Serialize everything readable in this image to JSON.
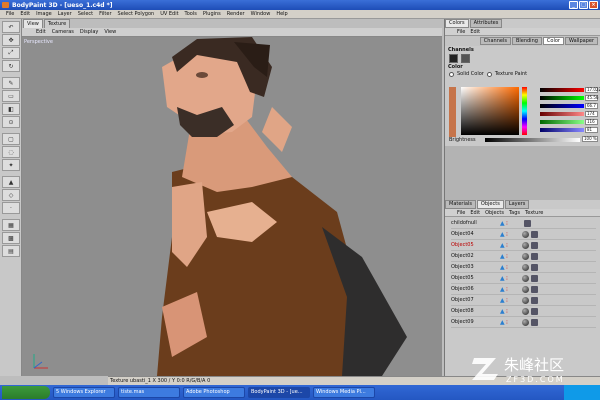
{
  "window": {
    "title": "BodyPaint 3D - [ueso_1.c4d *]"
  },
  "menubar": [
    "File",
    "Edit",
    "Image",
    "Layer",
    "Select",
    "Filter",
    "Select Polygon",
    "UV Edit",
    "Tools",
    "Plugins",
    "Render",
    "Window",
    "Help"
  ],
  "viewport": {
    "tabs": [
      "View",
      "Texture"
    ],
    "menu": [
      "Edit",
      "Cameras",
      "Display",
      "View"
    ],
    "label": "Perspective"
  },
  "color_panel": {
    "tabs": [
      "Colors",
      "Attributes"
    ],
    "menu": [
      "File",
      "Edit"
    ],
    "subtabs": [
      "Channels",
      "Blending",
      "Color",
      "Wallpaper"
    ],
    "channels_title": "Channels",
    "color_title": "Color",
    "solid_color_label": "Solid Color",
    "texture_paint_label": "Texture Paint",
    "brightness_label": "Brightness",
    "slider_values": [
      "17.022",
      "45.56",
      "66.7",
      "174",
      "116",
      "81"
    ],
    "brightness_value": "100 %"
  },
  "objects_panel": {
    "tabs": [
      "Materials",
      "Objects",
      "Layers"
    ],
    "menu": [
      "File",
      "Edit",
      "Objects",
      "Tags",
      "Texture"
    ],
    "rows": [
      {
        "name": "childofnull",
        "red": false
      },
      {
        "name": "Object04",
        "red": false
      },
      {
        "name": "Object05",
        "red": true
      },
      {
        "name": "Object02",
        "red": false
      },
      {
        "name": "Object03",
        "red": false
      },
      {
        "name": "Object05",
        "red": false
      },
      {
        "name": "Object06",
        "red": false
      },
      {
        "name": "Object07",
        "red": false
      },
      {
        "name": "Object08",
        "red": false
      },
      {
        "name": "Object09",
        "red": false
      }
    ]
  },
  "statusbar": {
    "text": "Texture ubasti_1    X 300 / Y 0:0 R/G/B/A 0"
  },
  "taskbar": {
    "items": [
      "5 Windows Explorer",
      "tiste.mas",
      "Adobe Photoshop",
      "BodyPaint 3D - [ue...",
      "Windows Media Pl..."
    ],
    "active_index": 3
  },
  "watermark": {
    "brand": "朱峰社区",
    "site": "ZF3D.COM"
  }
}
